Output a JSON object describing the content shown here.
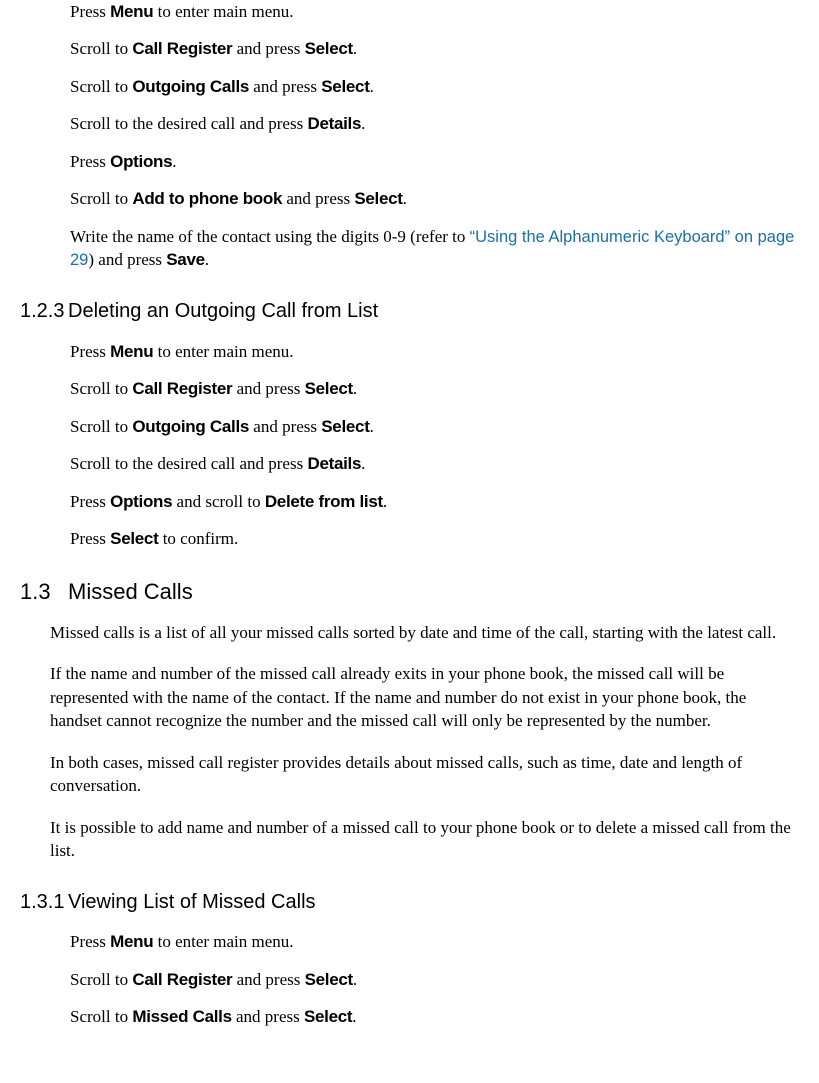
{
  "section1": {
    "steps": [
      {
        "pre": "Press ",
        "kw": "Menu",
        "mid": " to enter main menu.",
        "kw2": "",
        "post": ""
      },
      {
        "pre": "Scroll to ",
        "kw": "Call Register",
        "mid": " and press ",
        "kw2": "Select",
        "post": "."
      },
      {
        "pre": "Scroll to ",
        "kw": "Outgoing Calls",
        "mid": " and press ",
        "kw2": "Select",
        "post": "."
      },
      {
        "pre": "Scroll to the desired call and press ",
        "kw": "Details",
        "mid": ".",
        "kw2": "",
        "post": ""
      },
      {
        "pre": "Press ",
        "kw": "Options",
        "mid": ".",
        "kw2": "",
        "post": ""
      },
      {
        "pre": "Scroll to ",
        "kw": "Add to phone book",
        "mid": " and press ",
        "kw2": "Select",
        "post": "."
      }
    ],
    "step7": {
      "pre": "Write the name of the contact using the digits 0-9 (refer to ",
      "link": "“Using the Alphanumeric Keyboard” on page 29",
      "mid": ") and press ",
      "kw": "Save",
      "post": "."
    }
  },
  "h123": {
    "num": "1.2.3",
    "title": "Deleting an Outgoing Call from List"
  },
  "section123": {
    "steps": [
      {
        "pre": "Press ",
        "kw": "Menu",
        "mid": " to enter main menu.",
        "kw2": "",
        "post": ""
      },
      {
        "pre": "Scroll to ",
        "kw": "Call Register",
        "mid": " and press ",
        "kw2": "Select",
        "post": "."
      },
      {
        "pre": "Scroll to ",
        "kw": "Outgoing Calls",
        "mid": " and press ",
        "kw2": "Select",
        "post": "."
      },
      {
        "pre": "Scroll to the desired call and press ",
        "kw": "Details",
        "mid": ".",
        "kw2": "",
        "post": ""
      },
      {
        "pre": "Press ",
        "kw": "Options",
        "mid": " and scroll to ",
        "kw2": "Delete from list",
        "post": "."
      },
      {
        "pre": "Press ",
        "kw": "Select",
        "mid": " to confirm.",
        "kw2": "",
        "post": ""
      }
    ]
  },
  "h13": {
    "num": "1.3",
    "title": "Missed Calls"
  },
  "section13": {
    "p1": "Missed calls is a list of all your missed calls sorted by date and time of the call, starting with the latest call.",
    "p2": "If the name and number of the missed call already exits in your phone book, the missed call will be represented with the name of the contact. If the name and number do not exist in your phone book, the handset cannot recognize the number and the missed call will only be represented by the number.",
    "p3": "In both cases, missed call register provides details about missed calls, such as time, date and length of conversation.",
    "p4": "It is possible to add name and number of a missed call to your phone book or to delete a missed call from the list."
  },
  "h131": {
    "num": "1.3.1",
    "title": "Viewing List of Missed Calls"
  },
  "section131": {
    "steps": [
      {
        "pre": "Press ",
        "kw": "Menu",
        "mid": " to enter main menu.",
        "kw2": "",
        "post": ""
      },
      {
        "pre": "Scroll to ",
        "kw": "Call Register",
        "mid": " and press ",
        "kw2": "Select",
        "post": "."
      },
      {
        "pre": "Scroll to ",
        "kw": "Missed Calls",
        "mid": " and press ",
        "kw2": "Select",
        "post": "."
      }
    ]
  }
}
